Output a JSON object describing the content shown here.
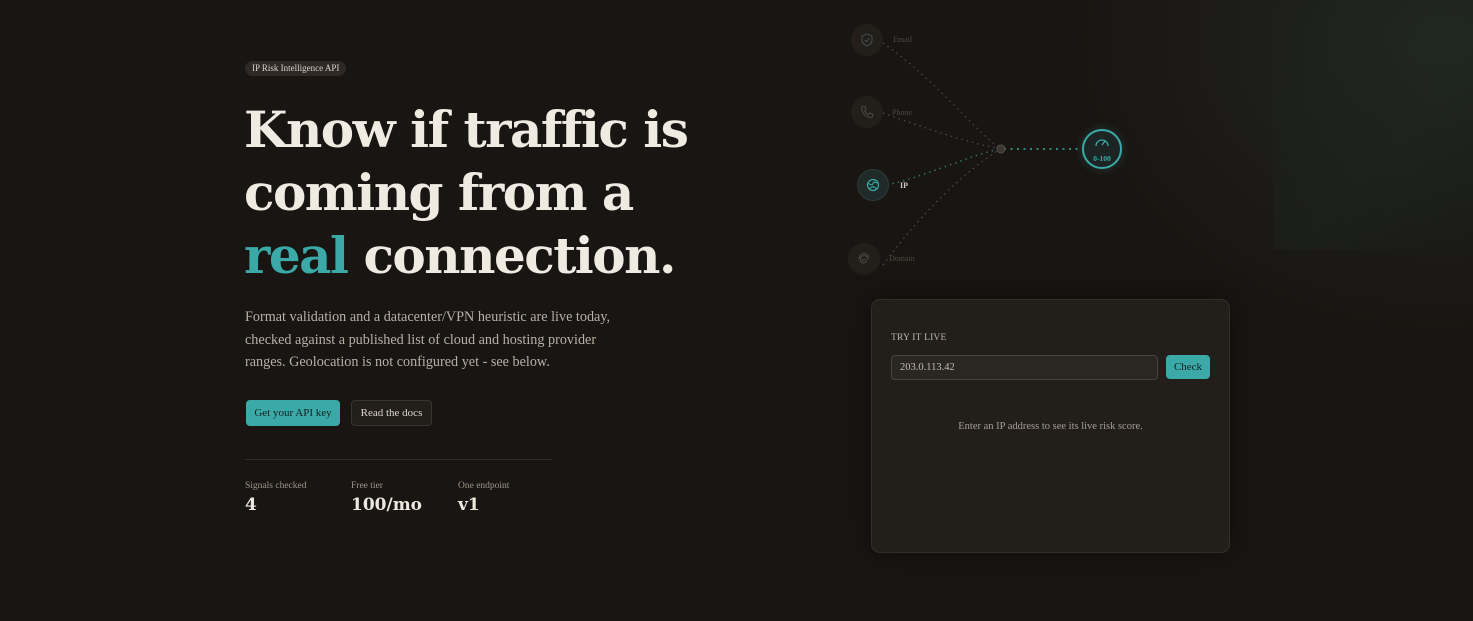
{
  "hero": {
    "badge": "IP Risk Intelligence API",
    "headline_line1": "Know if traffic is",
    "headline_line2": "coming from a",
    "headline_accent": "real",
    "headline_tail": " connection.",
    "lede": "Format validation and a datacenter/VPN heuristic are live today, checked against a published list of cloud and hosting provider ranges. Geolocation is not configured yet - see below.",
    "primary_button": "Get your API key",
    "secondary_button": "Read the docs",
    "stats": [
      {
        "label": "Signals checked",
        "value": "4"
      },
      {
        "label": "Free tier",
        "value": "100/mo"
      },
      {
        "label": "One endpoint",
        "value": "v1"
      }
    ]
  },
  "diagram": {
    "nodes": [
      {
        "label": "Email",
        "icon": "shield-icon",
        "active": false
      },
      {
        "label": "Phone",
        "icon": "phone-icon",
        "active": false
      },
      {
        "label": "IP",
        "icon": "globe-icon",
        "active": true
      },
      {
        "label": "Domain",
        "icon": "fingerprint-icon",
        "active": false
      }
    ],
    "score_label": "0-100",
    "score_icon": "gauge-icon",
    "accent_color": "#3aa9a7"
  },
  "try_panel": {
    "title": "TRY IT LIVE",
    "input_value": "203.0.113.42",
    "check_button": "Check",
    "hint": "Enter an IP address to see its live risk score."
  }
}
